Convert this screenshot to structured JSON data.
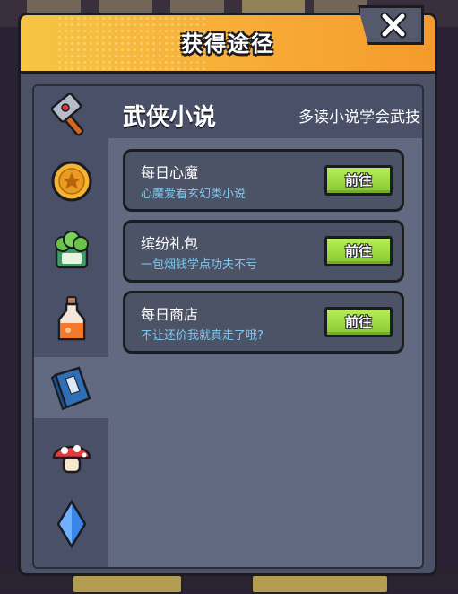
{
  "dialog": {
    "title": "获得途径"
  },
  "colors": {
    "header_gradient_start": "#f6c543",
    "header_gradient_end": "#f59a2d",
    "panel_bg": "#626a82",
    "sidebar_bg": "#4a5068",
    "button_green": "#9bdc3f",
    "desc_blue": "#7ec8f0"
  },
  "sidebar": {
    "items": [
      {
        "icon": "hammer-icon",
        "active": false
      },
      {
        "icon": "gold-coin-icon",
        "active": false
      },
      {
        "icon": "vegetable-can-icon",
        "active": false
      },
      {
        "icon": "potion-bottle-icon",
        "active": false
      },
      {
        "icon": "book-icon",
        "active": true
      },
      {
        "icon": "mushroom-icon",
        "active": false
      },
      {
        "icon": "blue-crystal-icon",
        "active": false
      }
    ]
  },
  "main": {
    "title": "武侠小说",
    "subtitle": "多读小说学会武技",
    "sources": [
      {
        "name": "每日心魔",
        "desc": "心魔爱看玄幻类小说",
        "button": "前往"
      },
      {
        "name": "缤纷礼包",
        "desc": "一包烟钱学点功夫不亏",
        "button": "前往"
      },
      {
        "name": "每日商店",
        "desc": "不让还价我就真走了哦?",
        "button": "前往"
      }
    ]
  }
}
